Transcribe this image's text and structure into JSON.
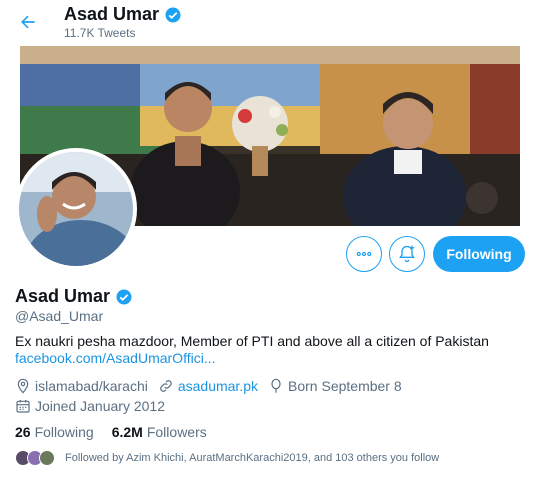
{
  "header": {
    "name": "Asad Umar",
    "tweet_count": "11.7K",
    "tweets_label": "Tweets"
  },
  "profile": {
    "name": "Asad Umar",
    "handle": "@Asad_Umar",
    "bio": "Ex naukri pesha mazdoor, Member of PTI  and above all a citizen of Pakistan",
    "bio_link": "facebook.com/AsadUmarOffici...",
    "location": "islamabad/karachi",
    "website": "asadumar.pk",
    "birthday": "Born September 8",
    "joined": "Joined January 2012",
    "verified": true
  },
  "actions": {
    "following_label": "Following"
  },
  "stats": {
    "following_count": "26",
    "following_label": "Following",
    "followers_count": "6.2M",
    "followers_label": "Followers"
  },
  "followed_by": {
    "text": "Followed by Azim Khichi, AuratMarchKarachi2019, and 103 others you follow"
  },
  "colors": {
    "accent": "#1da1f2",
    "link": "#1b95e0",
    "secondary_text": "#5b7083"
  },
  "icons": {
    "back": "arrow-left-icon",
    "verified": "verified-badge-icon",
    "more": "more-dots-icon",
    "notify": "bell-plus-icon",
    "location": "location-pin-icon",
    "website": "link-icon",
    "birthday": "balloon-icon",
    "joined": "calendar-icon"
  }
}
